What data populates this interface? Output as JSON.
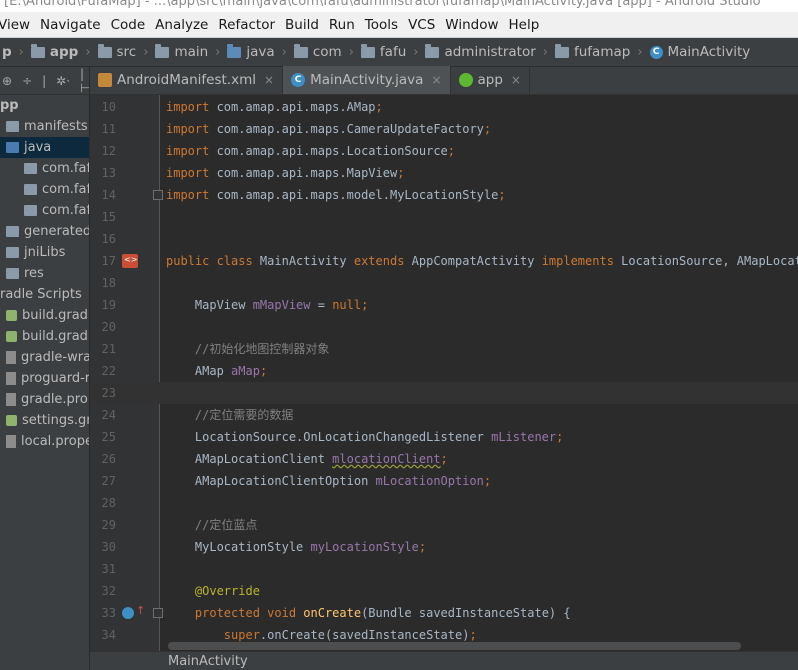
{
  "window": {
    "title": "[E:\\Android\\FufaMap] - ...\\app\\src\\main\\java\\com\\fafu\\administrator\\fufamap\\MainActivity.java [app] - Android Studio"
  },
  "menu": [
    "View",
    "Navigate",
    "Code",
    "Analyze",
    "Refactor",
    "Build",
    "Run",
    "Tools",
    "VCS",
    "Window",
    "Help"
  ],
  "breadcrumb": {
    "items": [
      {
        "label": "p",
        "icon": "none",
        "bold": true
      },
      {
        "label": "app",
        "icon": "folder",
        "bold": true
      },
      {
        "label": "src",
        "icon": "folder",
        "bold": false
      },
      {
        "label": "main",
        "icon": "folder",
        "bold": false
      },
      {
        "label": "java",
        "icon": "folder-blue",
        "bold": false
      },
      {
        "label": "com",
        "icon": "folder",
        "bold": false
      },
      {
        "label": "fafu",
        "icon": "folder",
        "bold": false
      },
      {
        "label": "administrator",
        "icon": "folder",
        "bold": false
      },
      {
        "label": "fufamap",
        "icon": "folder",
        "bold": false
      },
      {
        "label": "MainActivity",
        "icon": "class",
        "bold": false
      }
    ]
  },
  "project_toolbar": [
    "⊕",
    "÷",
    "|",
    "✲·",
    "|⊢"
  ],
  "project_tree": [
    {
      "label": "pp",
      "icon": "none",
      "selected": false
    },
    {
      "label": "manifests",
      "icon": "folder",
      "selected": false
    },
    {
      "label": "java",
      "icon": "folder-blue",
      "selected": true
    },
    {
      "label": "com.fafu.ac",
      "icon": "folder",
      "selected": false
    },
    {
      "label": "com.fafu.ac",
      "icon": "folder",
      "selected": false
    },
    {
      "label": "com.fafu.ac",
      "icon": "folder",
      "selected": false
    },
    {
      "label": "generatedJava",
      "icon": "folder",
      "selected": false
    },
    {
      "label": "jniLibs",
      "icon": "folder",
      "selected": false
    },
    {
      "label": "res",
      "icon": "folder",
      "selected": false
    },
    {
      "label": "radle Scripts",
      "icon": "none",
      "selected": false
    },
    {
      "label": "build.gradle (P",
      "icon": "gradle",
      "selected": false
    },
    {
      "label": "build.gradle (M",
      "icon": "gradle",
      "selected": false
    },
    {
      "label": "gradle-wrappe",
      "icon": "props",
      "selected": false
    },
    {
      "label": "proguard-rule",
      "icon": "props",
      "selected": false
    },
    {
      "label": "gradle.proper",
      "icon": "props",
      "selected": false
    },
    {
      "label": "settings.gradle",
      "icon": "gradle",
      "selected": false
    },
    {
      "label": "local.propertie",
      "icon": "props",
      "selected": false
    }
  ],
  "tabs": [
    {
      "label": "AndroidManifest.xml",
      "icon": "manifest",
      "active": false,
      "close": "×"
    },
    {
      "label": "MainActivity.java",
      "icon": "java",
      "active": true,
      "close": "×"
    },
    {
      "label": "app",
      "icon": "app",
      "active": false,
      "close": "×"
    }
  ],
  "editor": {
    "current_line": 23,
    "lines": [
      {
        "n": "10",
        "tokens": [
          [
            "kw",
            "import "
          ],
          [
            "p",
            "com.amap.api.maps.AMap"
          ],
          [
            "kw",
            ";"
          ]
        ]
      },
      {
        "n": "11",
        "tokens": [
          [
            "kw",
            "import "
          ],
          [
            "p",
            "com.amap.api.maps.CameraUpdateFactory"
          ],
          [
            "kw",
            ";"
          ]
        ]
      },
      {
        "n": "12",
        "tokens": [
          [
            "kw",
            "import "
          ],
          [
            "p",
            "com.amap.api.maps.LocationSource"
          ],
          [
            "kw",
            ";"
          ]
        ]
      },
      {
        "n": "13",
        "tokens": [
          [
            "kw",
            "import "
          ],
          [
            "p",
            "com.amap.api.maps.MapView"
          ],
          [
            "kw",
            ";"
          ]
        ]
      },
      {
        "n": "14",
        "tokens": [
          [
            "kw",
            "import "
          ],
          [
            "p",
            "com.amap.api.maps.model.MyLocationStyle"
          ],
          [
            "kw",
            ";"
          ]
        ]
      },
      {
        "n": "15",
        "tokens": []
      },
      {
        "n": "16",
        "tokens": []
      },
      {
        "n": "17",
        "tokens": [
          [
            "kw",
            "public class "
          ],
          [
            "p",
            "MainActivity "
          ],
          [
            "kw",
            "extends "
          ],
          [
            "p",
            "AppCompatActivity "
          ],
          [
            "kw",
            "implements "
          ],
          [
            "p",
            "LocationSource, AMapLocationListener"
          ]
        ]
      },
      {
        "n": "18",
        "tokens": []
      },
      {
        "n": "19",
        "tokens": [
          [
            "p",
            "    MapView "
          ],
          [
            "fld",
            "mMapView"
          ],
          [
            "p",
            " = "
          ],
          [
            "kw",
            "null;"
          ]
        ]
      },
      {
        "n": "20",
        "tokens": []
      },
      {
        "n": "21",
        "tokens": [
          [
            "cmt",
            "    //初始化地图控制器对象"
          ]
        ]
      },
      {
        "n": "22",
        "tokens": [
          [
            "p",
            "    AMap "
          ],
          [
            "fld",
            "aMap"
          ],
          [
            "kw",
            ";"
          ]
        ]
      },
      {
        "n": "23",
        "tokens": []
      },
      {
        "n": "24",
        "tokens": [
          [
            "cmt",
            "    //定位需要的数据"
          ]
        ]
      },
      {
        "n": "25",
        "tokens": [
          [
            "p",
            "    LocationSource.OnLocationChangedListener "
          ],
          [
            "fld",
            "mListener"
          ],
          [
            "kw",
            ";"
          ]
        ]
      },
      {
        "n": "26",
        "tokens": [
          [
            "p",
            "    AMapLocationClient "
          ],
          [
            "fldsq",
            "mlocationClient"
          ],
          [
            "kw",
            ";"
          ]
        ]
      },
      {
        "n": "27",
        "tokens": [
          [
            "p",
            "    AMapLocationClientOption "
          ],
          [
            "fld",
            "mLocationOption"
          ],
          [
            "kw",
            ";"
          ]
        ]
      },
      {
        "n": "28",
        "tokens": []
      },
      {
        "n": "29",
        "tokens": [
          [
            "cmt",
            "    //定位蓝点"
          ]
        ]
      },
      {
        "n": "30",
        "tokens": [
          [
            "p",
            "    MyLocationStyle "
          ],
          [
            "fld",
            "myLocationStyle"
          ],
          [
            "kw",
            ";"
          ]
        ]
      },
      {
        "n": "31",
        "tokens": []
      },
      {
        "n": "32",
        "tokens": [
          [
            "ann",
            "    @Override"
          ]
        ]
      },
      {
        "n": "33",
        "tokens": [
          [
            "kw",
            "    protected void "
          ],
          [
            "mth",
            "onCreate"
          ],
          [
            "p",
            "(Bundle savedInstanceState) {"
          ]
        ]
      },
      {
        "n": "34",
        "tokens": [
          [
            "kw",
            "        super"
          ],
          [
            "p",
            "."
          ],
          [
            "p",
            "onCreate(savedInstanceState)"
          ],
          [
            "kw",
            ";"
          ]
        ]
      }
    ]
  },
  "bottom_breadcrumb": "MainActivity",
  "colors": {
    "keyword": "#cc7832",
    "field": "#9876aa",
    "comment": "#808080",
    "annotation": "#bbb529",
    "method": "#ffc66d",
    "plain": "#a9b7c6",
    "editor_bg": "#2b2b2b",
    "panel_bg": "#3c3f41",
    "selection": "#0d293e"
  }
}
